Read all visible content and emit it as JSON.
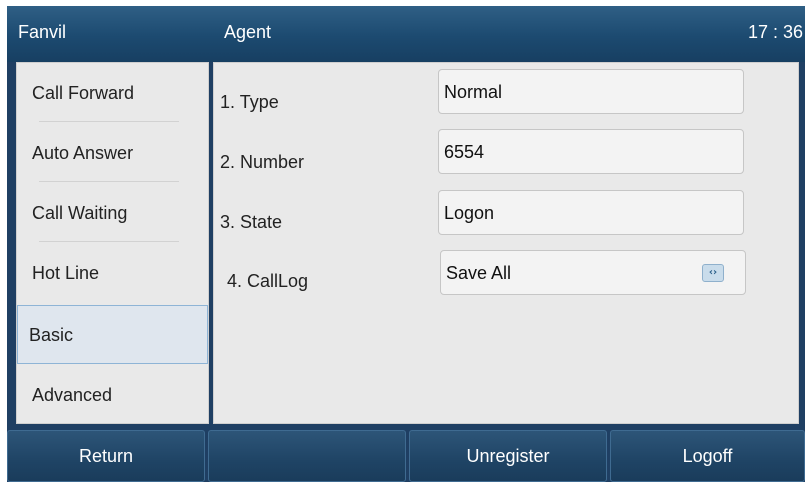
{
  "topbar": {
    "brand": "Fanvil",
    "title": "Agent",
    "time": "17 : 36"
  },
  "sidebar": {
    "items": [
      {
        "label": "Call Forward"
      },
      {
        "label": "Auto Answer"
      },
      {
        "label": "Call Waiting"
      },
      {
        "label": "Hot Line"
      },
      {
        "label": "Basic",
        "selected": true
      },
      {
        "label": "Advanced"
      }
    ]
  },
  "form": {
    "rows": [
      {
        "label": "1. Type",
        "value": "Normal"
      },
      {
        "label": "2. Number",
        "value": "6554"
      },
      {
        "label": "3. State",
        "value": "Logon"
      },
      {
        "label": "4. CallLog",
        "value": "Save All",
        "switch_icon": "left-right-switch-icon",
        "switch_glyph": "‹›"
      }
    ]
  },
  "softkeys": {
    "return_label": "Return",
    "empty_label": "",
    "unregister_label": "Unregister",
    "logoff_label": "Logoff"
  },
  "colors": {
    "header": "#1c4a70",
    "softkey": "#1f4465",
    "panel": "#e9e9e9",
    "selection_border": "#8eb4d6"
  }
}
